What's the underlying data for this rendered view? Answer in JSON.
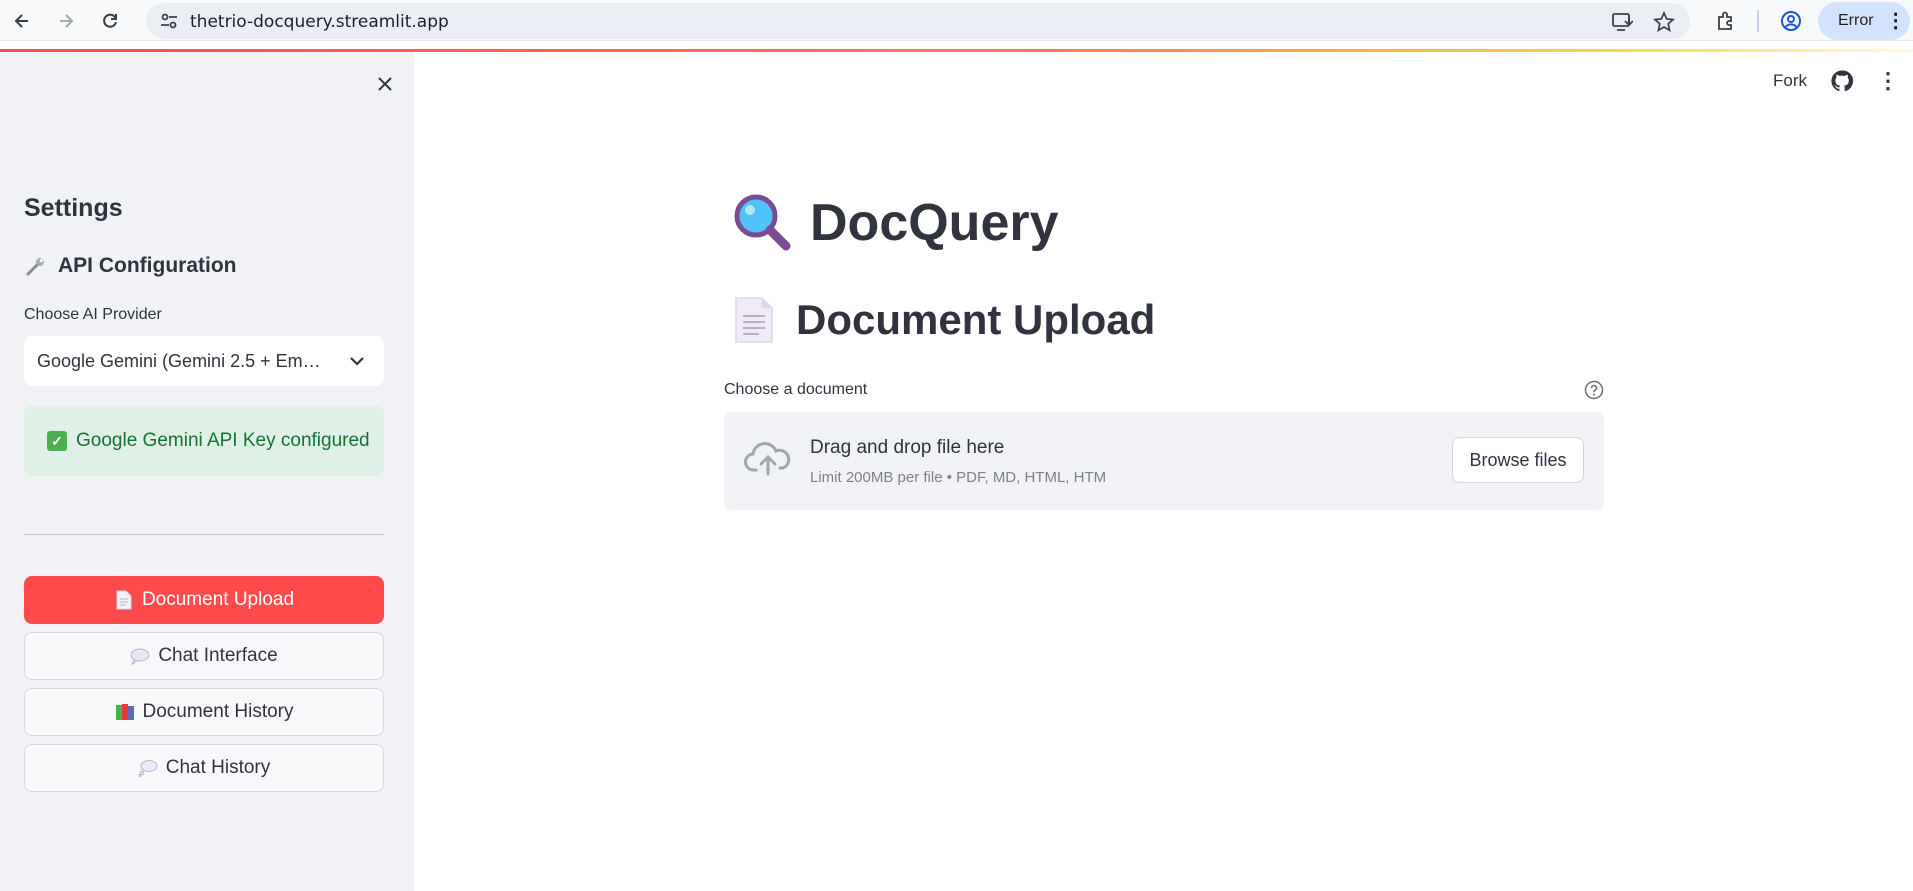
{
  "browser": {
    "url": "thetrio-docquery.streamlit.app",
    "profile_status": "Error",
    "icons": [
      "back-icon",
      "forward-icon",
      "reload-icon",
      "site-settings-icon",
      "install-app-icon",
      "bookmark-star-icon",
      "extensions-icon",
      "profile-icon",
      "more-vert-icon"
    ]
  },
  "sidebar": {
    "title": "Settings",
    "section_title": "API Configuration",
    "provider_label": "Choose AI Provider",
    "provider_value": "Google Gemini (Gemini 2.5 + Em…",
    "success_message": "Google Gemini API Key configured",
    "nav": [
      {
        "label": "Document Upload",
        "icon": "page-icon",
        "active": true
      },
      {
        "label": "Chat Interface",
        "icon": "speech-bubble-icon",
        "active": false
      },
      {
        "label": "Document History",
        "icon": "books-icon",
        "active": false
      },
      {
        "label": "Chat History",
        "icon": "thought-bubble-icon",
        "active": false
      }
    ]
  },
  "toolbar": {
    "fork_label": "Fork"
  },
  "main": {
    "app_title": "DocQuery",
    "section_title": "Document Upload",
    "uploader": {
      "label": "Choose a document",
      "drop_text": "Drag and drop file here",
      "limit_text": "Limit 200MB per file • PDF, MD, HTML, HTM",
      "browse_label": "Browse files"
    }
  },
  "colors": {
    "primary": "#ff4b4b",
    "sidebar_bg": "#f0f2f6",
    "success_bg": "#dff0e6",
    "success_text": "#177233",
    "text": "#31333f"
  }
}
